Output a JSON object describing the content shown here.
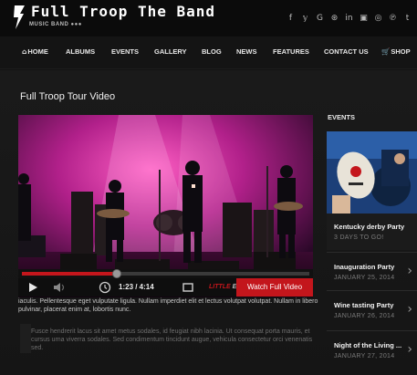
{
  "header": {
    "overlay_title": "Full Troop The Band",
    "tagline": "MUSIC BAND ●●●",
    "social_icons": [
      {
        "name": "facebook-icon",
        "glyph": "f"
      },
      {
        "name": "twitter-icon",
        "glyph": "𝕪"
      },
      {
        "name": "google-plus-icon",
        "glyph": "G"
      },
      {
        "name": "dribbble-icon",
        "glyph": "⊛"
      },
      {
        "name": "linkedin-icon",
        "glyph": "in"
      },
      {
        "name": "youtube-icon",
        "glyph": "▣"
      },
      {
        "name": "instagram-icon",
        "glyph": "◎"
      },
      {
        "name": "pinterest-icon",
        "glyph": "℗"
      },
      {
        "name": "tumblr-icon",
        "glyph": "t"
      }
    ]
  },
  "nav": {
    "items": [
      {
        "label": "HOME",
        "icon": "⌂"
      },
      {
        "label": "ALBUMS"
      },
      {
        "label": "EVENTS"
      },
      {
        "label": "GALLERY"
      },
      {
        "label": "BLOG"
      },
      {
        "label": "NEWS"
      },
      {
        "label": "FEATURES"
      },
      {
        "label": "CONTACT US"
      },
      {
        "label": "SHOP",
        "icon": "🛒"
      }
    ]
  },
  "main": {
    "section_title": "Full Troop Tour Video",
    "video": {
      "time": "1:23 / 4:14",
      "progress": 0.33,
      "brand_left": "LITTLE",
      "brand_right": "EAST",
      "watch_label": "Watch Full Video"
    },
    "paragraph1": "iaculis. Pellentesque eget vulputate ligula. Nullam imperdiet elit et lectus volutpat volutpat. Nullam in libero pulvinar, placerat enim at, lobortis nunc.",
    "paragraph2": "Fusce hendrerit lacus sit amet metus sodales, id feugiat nibh lacinia. Ut consequat porta mauris, et cursus urna viverra sodales. Sed condimentum tincidunt augue, vehicula consectetur orci venenatis sed."
  },
  "sidebar": {
    "title": "EVENTS",
    "events": [
      {
        "title": "Kentucky derby Party",
        "date": "3 DAYS TO GO!"
      },
      {
        "title": "Inauguration Party",
        "date": "JANUARY 25, 2014"
      },
      {
        "title": "Wine tasting Party",
        "date": "JANUARY 26, 2014"
      },
      {
        "title": "Night of the Living ...",
        "date": "JANUARY 27, 2014"
      }
    ]
  },
  "colors": {
    "accent": "#c3161c",
    "background": "#121212"
  }
}
